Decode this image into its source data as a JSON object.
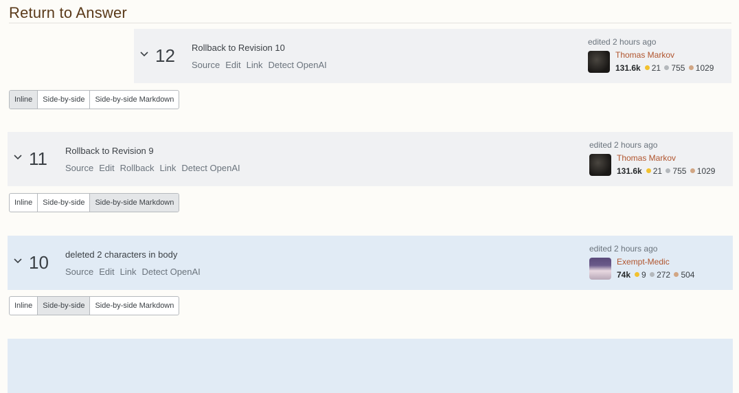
{
  "page": {
    "title": "Return to Answer"
  },
  "view_modes": [
    "Inline",
    "Side-by-side",
    "Side-by-side Markdown"
  ],
  "revisions": [
    {
      "number": "12",
      "comment": "Rollback to Revision 10",
      "links": [
        "Source",
        "Edit",
        "Link",
        "Detect OpenAI"
      ],
      "edited": "edited 2 hours ago",
      "user": {
        "name": "Thomas Markov",
        "reputation": "131.6k",
        "gold": "21",
        "silver": "755",
        "bronze": "1029"
      },
      "active_view": "Inline"
    },
    {
      "number": "11",
      "comment": "Rollback to Revision 9",
      "links": [
        "Source",
        "Edit",
        "Rollback",
        "Link",
        "Detect OpenAI"
      ],
      "edited": "edited 2 hours ago",
      "user": {
        "name": "Thomas Markov",
        "reputation": "131.6k",
        "gold": "21",
        "silver": "755",
        "bronze": "1029"
      },
      "active_view": "Side-by-side Markdown"
    },
    {
      "number": "10",
      "comment": "deleted 2 characters in body",
      "links": [
        "Source",
        "Edit",
        "Link",
        "Detect OpenAI"
      ],
      "edited": "edited 2 hours ago",
      "user": {
        "name": "Exempt-Medic",
        "reputation": "74k",
        "gold": "9",
        "silver": "272",
        "bronze": "504"
      },
      "active_view": "Side-by-side"
    }
  ],
  "colors": {
    "username": "#b0542d",
    "title": "#5a3a1a",
    "gold": "#f2c12e",
    "silver": "#b4b8bc",
    "bronze": "#d1a684"
  }
}
